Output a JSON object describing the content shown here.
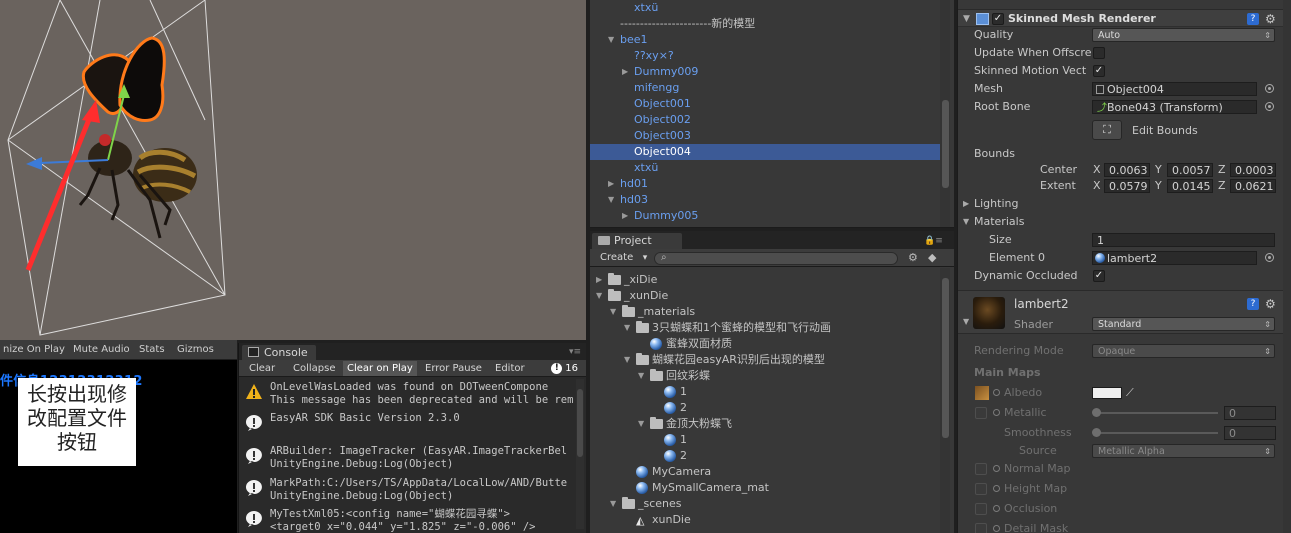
{
  "scene": {},
  "game": {
    "toolbar": [
      "nize On Play",
      "Mute Audio",
      "Stats",
      "Gizmos"
    ],
    "overlay_tag": "件信息12312312312",
    "overlay_lines": [
      "长按出现修",
      "改配置文件",
      "按钮"
    ]
  },
  "console": {
    "tab": "Console",
    "toolbar": [
      "Clear",
      "Collapse",
      "Clear on Play",
      "Error Pause",
      "Editor"
    ],
    "error_count": "16",
    "entries": [
      {
        "severity": "warning",
        "line1": "OnLevelWasLoaded was found on DOTweenCompone",
        "line2": "This message has been deprecated and will be remo"
      },
      {
        "severity": "info",
        "line1": "EasyAR SDK Basic Version 2.3.0",
        "line2": ""
      },
      {
        "severity": "info",
        "line1": "ARBuilder: ImageTracker (EasyAR.ImageTrackerBel",
        "line2": "UnityEngine.Debug:Log(Object)"
      },
      {
        "severity": "info",
        "line1": "MarkPath:C:/Users/TS/AppData/LocalLow/AND/Butte",
        "line2": "UnityEngine.Debug:Log(Object)"
      },
      {
        "severity": "info",
        "line1": "MyTestXml05:<config name=\"蝴蝶花园寻蝶\">",
        "line2": "  <target0 x=\"0.044\" y=\"1.825\" z=\"-0.006\" />"
      }
    ]
  },
  "hierarchy": {
    "rows": [
      {
        "label": "xtxü",
        "color": "blue",
        "expanded": null,
        "indent": 1
      },
      {
        "label": "-----------------------新的模型",
        "color": "grey",
        "expanded": null,
        "indent": 0
      },
      {
        "label": "bee1",
        "color": "blue",
        "expanded": true,
        "indent": 0
      },
      {
        "label": "??xy×?",
        "color": "blue",
        "expanded": null,
        "indent": 1
      },
      {
        "label": "Dummy009",
        "color": "blue",
        "expanded": false,
        "indent": 1
      },
      {
        "label": "mifengg",
        "color": "blue",
        "expanded": null,
        "indent": 1
      },
      {
        "label": "Object001",
        "color": "blue",
        "expanded": null,
        "indent": 1
      },
      {
        "label": "Object002",
        "color": "blue",
        "expanded": null,
        "indent": 1
      },
      {
        "label": "Object003",
        "color": "blue",
        "expanded": null,
        "indent": 1
      },
      {
        "label": "Object004",
        "color": "blue",
        "expanded": null,
        "indent": 1,
        "selected": true
      },
      {
        "label": "xtxü",
        "color": "blue",
        "expanded": null,
        "indent": 1
      },
      {
        "label": "hd01",
        "color": "blue",
        "expanded": false,
        "indent": 0
      },
      {
        "label": "hd03",
        "color": "blue",
        "expanded": true,
        "indent": 0
      },
      {
        "label": "Dummy005",
        "color": "blue",
        "expanded": false,
        "indent": 1
      }
    ]
  },
  "project": {
    "tab": "Project",
    "create_label": "Create",
    "tree": [
      {
        "label": "_xiDie",
        "icon": "folder",
        "expanded": false,
        "indent": 0
      },
      {
        "label": "_xunDie",
        "icon": "folder",
        "expanded": true,
        "indent": 0
      },
      {
        "label": "_materials",
        "icon": "folder",
        "expanded": true,
        "indent": 1
      },
      {
        "label": "3只蝴蝶和1个蜜蜂的模型和飞行动画",
        "icon": "folder",
        "expanded": true,
        "indent": 2
      },
      {
        "label": "蜜蜂双面材质",
        "icon": "material",
        "expanded": null,
        "indent": 3
      },
      {
        "label": "蝴蝶花园easyAR识别后出现的模型",
        "icon": "folder",
        "expanded": true,
        "indent": 2
      },
      {
        "label": "回纹彩蝶",
        "icon": "folder",
        "expanded": true,
        "indent": 3
      },
      {
        "label": "1",
        "icon": "material",
        "expanded": null,
        "indent": 4
      },
      {
        "label": "2",
        "icon": "material",
        "expanded": null,
        "indent": 4
      },
      {
        "label": "金顶大粉蝶飞",
        "icon": "folder",
        "expanded": true,
        "indent": 3
      },
      {
        "label": "1",
        "icon": "material",
        "expanded": null,
        "indent": 4
      },
      {
        "label": "2",
        "icon": "material",
        "expanded": null,
        "indent": 4
      },
      {
        "label": "MyCamera",
        "icon": "material",
        "expanded": null,
        "indent": 2
      },
      {
        "label": "MySmallCamera_mat",
        "icon": "material",
        "expanded": null,
        "indent": 2
      },
      {
        "label": "_scenes",
        "icon": "folder",
        "expanded": true,
        "indent": 1
      },
      {
        "label": "xunDie",
        "icon": "unity",
        "expanded": null,
        "indent": 2
      }
    ]
  },
  "inspector": {
    "component_title": "Skinned Mesh Renderer",
    "quality_label": "Quality",
    "quality_value": "Auto",
    "update_offscreen_label": "Update When Offscre",
    "update_offscreen_checked": false,
    "skinned_motion_label": "Skinned Motion Vect",
    "skinned_motion_checked": true,
    "mesh_label": "Mesh",
    "mesh_value": "Object004",
    "root_bone_label": "Root Bone",
    "root_bone_value": "Bone043 (Transform)",
    "edit_bounds_label": "Edit Bounds",
    "bounds_label": "Bounds",
    "center_label": "Center",
    "center": {
      "x": "0.0063",
      "y": "0.0057",
      "z": "0.0003"
    },
    "extent_label": "Extent",
    "extent": {
      "x": "0.0579",
      "y": "0.0145",
      "z": "0.0621"
    },
    "lighting_label": "Lighting",
    "materials_label": "Materials",
    "size_label": "Size",
    "size_value": "1",
    "element0_label": "Element 0",
    "element0_value": "lambert2",
    "dynamic_occluded_label": "Dynamic Occluded",
    "dynamic_occluded_checked": true,
    "material_name": "lambert2",
    "shader_label": "Shader",
    "shader_value": "Standard",
    "rendering_mode_label": "Rendering Mode",
    "rendering_mode_value": "Opaque",
    "main_maps_label": "Main Maps",
    "albedo_label": "Albedo",
    "metallic_label": "Metallic",
    "metallic_value": "0",
    "smoothness_label": "Smoothness",
    "smoothness_value": "0",
    "source_label": "Source",
    "source_value": "Metallic Alpha",
    "normal_map_label": "Normal Map",
    "height_map_label": "Height Map",
    "occlusion_label": "Occlusion",
    "detail_mask_label": "Detail Mask"
  }
}
